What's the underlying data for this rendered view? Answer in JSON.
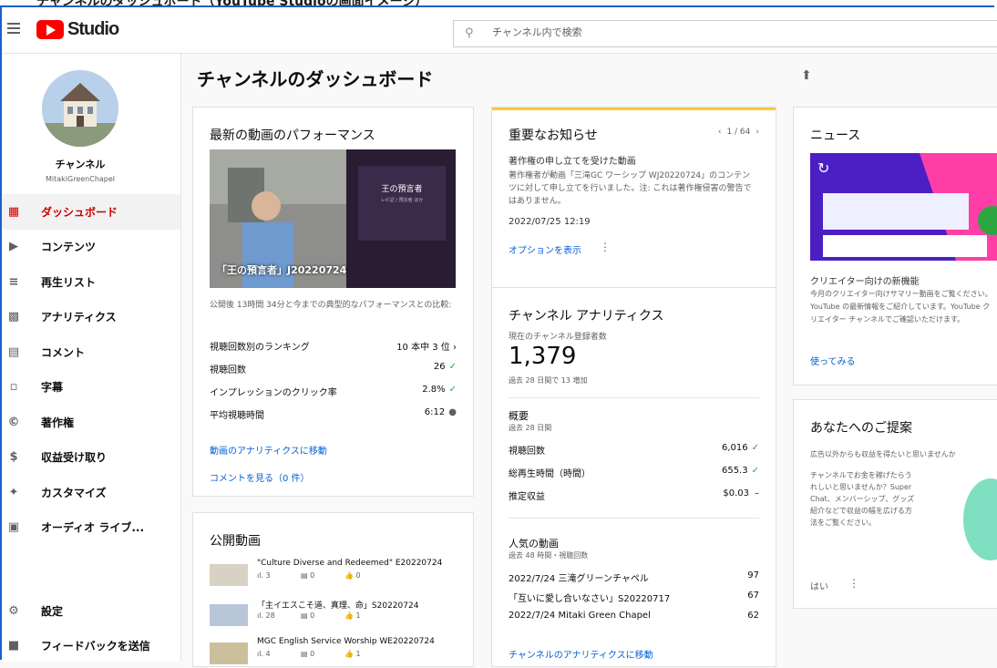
{
  "top_caption": "チャンネルのダッシュボード（YouTube Studioの画面イメージ）",
  "header": {
    "logo_text": "Studio",
    "search_placeholder": "チャンネル内で検索"
  },
  "sidebar": {
    "channel_name": "チャンネル",
    "channel_handle": "MitakiGreenChapel",
    "items": [
      {
        "label": "ダッシュボード",
        "icon": "dashboard-icon",
        "active": true
      },
      {
        "label": "コンテンツ",
        "icon": "content-icon"
      },
      {
        "label": "再生リスト",
        "icon": "playlist-icon"
      },
      {
        "label": "アナリティクス",
        "icon": "analytics-icon"
      },
      {
        "label": "コメント",
        "icon": "comment-icon"
      },
      {
        "label": "字幕",
        "icon": "subtitles-icon"
      },
      {
        "label": "著作権",
        "icon": "copyright-icon"
      },
      {
        "label": "収益受け取り",
        "icon": "dollar-icon"
      },
      {
        "label": "カスタマイズ",
        "icon": "customize-icon"
      },
      {
        "label": "オーディオ ライブ...",
        "icon": "audio-library-icon"
      }
    ],
    "bottom_items": [
      {
        "label": "設定",
        "icon": "settings-icon"
      },
      {
        "label": "フィードバックを送信",
        "icon": "feedback-icon"
      }
    ]
  },
  "main": {
    "title": "チャンネルのダッシュボード",
    "latest_video": {
      "heading": "最新の動画のパフォーマンス",
      "thumb_caption": "「王の預言者」J20220724",
      "thumb_slide_title": "王の預言者",
      "thumb_slide_sub": "レビ記 / 預言者 ほか",
      "comparison": "公開後 13時間 34分と今までの典型的なパフォーマンスとの比較:",
      "rows": [
        {
          "label": "視聴回数別のランキング",
          "value": "10 本中 3 位",
          "suffix": "›"
        },
        {
          "label": "視聴回数",
          "value": "26",
          "suffix": "✓"
        },
        {
          "label": "インプレッションのクリック率",
          "value": "2.8%",
          "suffix": "✓"
        },
        {
          "label": "平均視聴時間",
          "value": "6:12",
          "suffix": "●"
        }
      ],
      "link_analytics": "動画のアナリティクスに移動",
      "link_comments": "コメントを見る（0 件）"
    },
    "published": {
      "heading": "公開動画",
      "videos": [
        {
          "title": "\"Culture Diverse and Redeemed\" E20220724",
          "views": "3",
          "comments": "0",
          "likes": "0"
        },
        {
          "title": "「主イエスこそ道、真理、命」S20220724",
          "views": "28",
          "comments": "0",
          "likes": "1"
        },
        {
          "title": "MGC English Service Worship WE20220724",
          "views": "4",
          "comments": "0",
          "likes": "1"
        }
      ]
    },
    "notice": {
      "heading": "重要なお知らせ",
      "pager": "1 / 64",
      "subtitle": "著作権の申し立てを受けた動画",
      "body": "著作権者が動画「三滝GC ワーシップ WJ20220724」のコンテンツに対して申し立てを行いました。注: これは著作権侵害の警告ではありません。",
      "date": "2022/07/25 12:19",
      "link": "オプションを表示"
    },
    "analytics": {
      "heading": "チャンネル アナリティクス",
      "subs_label": "現在のチャンネル登録者数",
      "subs_value": "1,379",
      "subs_change": "過去 28 日間で 13 増加",
      "summary_label": "概要",
      "summary_period": "過去 28 日間",
      "rows": [
        {
          "label": "視聴回数",
          "value": "6,016",
          "suffix": "✓"
        },
        {
          "label": "総再生時間（時間）",
          "value": "655.3",
          "suffix": "✓"
        },
        {
          "label": "推定収益",
          "value": "$0.03",
          "suffix": "–"
        }
      ],
      "popular_label": "人気の動画",
      "popular_period": "過去 48 時間・視聴回数",
      "popular": [
        {
          "title": "2022/7/24 三滝グリーンチャペル",
          "value": "97"
        },
        {
          "title": "「互いに愛し合いなさい」S20220717",
          "value": "67"
        },
        {
          "title": "2022/7/24 Mitaki Green Chapel",
          "value": "62"
        }
      ],
      "link": "チャンネルのアナリティクスに移動"
    },
    "news": {
      "heading": "ニュース",
      "subtitle": "クリエイター向けの新機能",
      "body": "今月のクリエイター向けサマリー動画をご覧ください。YouTube の最新情報をご紹介しています。YouTube クリエイター チャンネルでご確認いただけます。",
      "link": "使ってみる"
    },
    "suggest": {
      "heading": "あなたへのご提案",
      "subtitle": "広告以外からも収益を得たいと思いませんか",
      "body": "チャンネルでお金を稼げたらうれしいと思いませんか？Super Chat、メンバーシップ、グッズ紹介などで収益の幅を広げる方法をご覧ください。",
      "link": "はい"
    }
  }
}
